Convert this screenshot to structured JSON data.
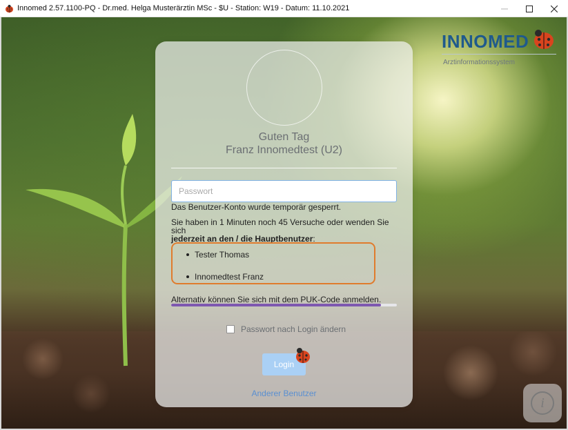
{
  "window": {
    "title": "Innomed 2.57.1100-PQ - Dr.med. Helga Musterärztin MSc - $U - Station: W19 - Datum: 11.10.2021",
    "minimize_symbol": "—",
    "maximize_symbol": "☐",
    "close_symbol": "✕"
  },
  "logo": {
    "text": "INNOMED",
    "subtitle": "Arztinformationssystem",
    "icon": "ladybug-icon"
  },
  "login": {
    "greeting": "Guten Tag",
    "user_name": "Franz Innomedtest (U2)",
    "password_placeholder": "Passwort",
    "password_value": "",
    "locked_message": "Das Benutzer-Konto wurde temporär gesperrt.",
    "attempts_message": "Sie haben in 1 Minuten noch 45 Versuche oder wenden Sie sich",
    "attempts_message_bold": "jederzeit an den / die Hauptbenutzer",
    "attempts_message_end": ":",
    "admins": [
      "Tester Thomas",
      "Innomedtest Franz"
    ],
    "puk_link": "Alternativ können Sie sich mit dem PUK-Code anmelden.",
    "countdown_progress": 0.93,
    "change_password_label": "Passwort nach Login ändern",
    "change_password_checked": false,
    "login_button": "Login",
    "other_user_link": "Anderer Benutzer"
  },
  "info_button": {
    "icon": "info-icon",
    "glyph": "i"
  },
  "colors": {
    "logo_blue": "#1f5a8c",
    "highlight_orange": "#e07b2c",
    "progress_purple": "#7e58b0",
    "login_button": "#aad0f5",
    "link_blue": "#5a8fd1"
  }
}
